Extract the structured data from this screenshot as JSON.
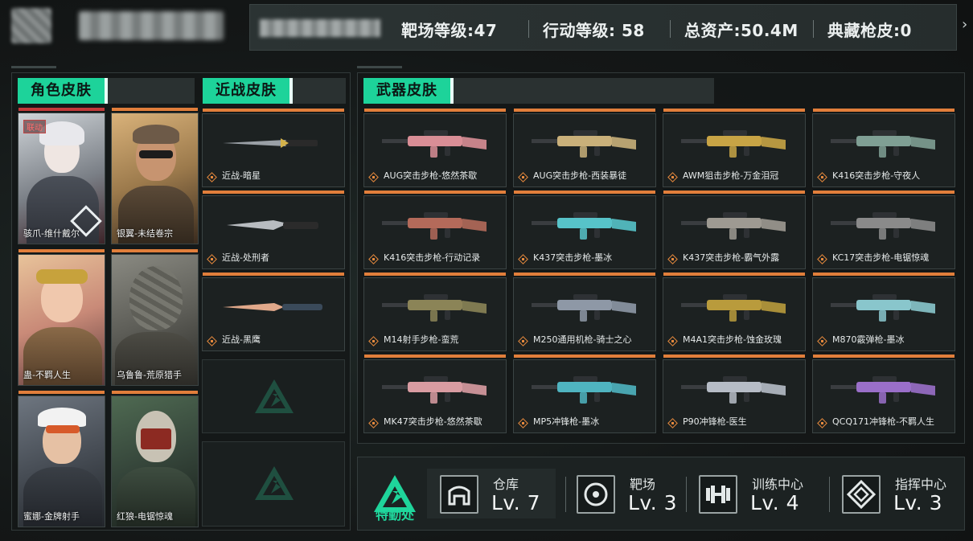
{
  "header": {
    "stats": [
      {
        "label": "靶场等级:47"
      },
      {
        "label": "行动等级: 58"
      },
      {
        "label": "总资产:50.4M"
      },
      {
        "label": "典藏枪皮:0"
      }
    ],
    "next_icon": "chevron-right-icon"
  },
  "character_skins": {
    "title": "角色皮肤",
    "items": [
      {
        "name": "骇爪-维什戴尔",
        "badge": "联动"
      },
      {
        "name": "银翼-未结卷宗"
      },
      {
        "name": "蛊-不羁人生"
      },
      {
        "name": "乌鲁鲁-荒原猎手"
      },
      {
        "name": "蜜娜-金牌射手"
      },
      {
        "name": "红狼-电锯惊魂"
      }
    ]
  },
  "melee_skins": {
    "title": "近战皮肤",
    "items": [
      {
        "name": "近战-暗星"
      },
      {
        "name": "近战-处刑者"
      },
      {
        "name": "近战-黑鹰"
      }
    ]
  },
  "weapon_skins": {
    "title": "武器皮肤",
    "items": [
      {
        "name": "AUG突击步枪-悠然茶歇",
        "color": "#d98e96"
      },
      {
        "name": "AUG突击步枪-西装暴徒",
        "color": "#c9b07a"
      },
      {
        "name": "AWM狙击步枪-万金泪冠",
        "color": "#c8a445"
      },
      {
        "name": "K416突击步枪-守夜人",
        "color": "#7f9f94"
      },
      {
        "name": "K416突击步枪-行动记录",
        "color": "#b46a5a"
      },
      {
        "name": "K437突击步枪-墨冰",
        "color": "#57c3c9"
      },
      {
        "name": "K437突击步枪-霸气外露",
        "color": "#9e9a92"
      },
      {
        "name": "KC17突击步枪-电锯惊魂",
        "color": "#8a8a8a"
      },
      {
        "name": "M14射手步枪-蛮荒",
        "color": "#8b8457"
      },
      {
        "name": "M250通用机枪-骑士之心",
        "color": "#8e98a6"
      },
      {
        "name": "M4A1突击步枪-蚀金玫瑰",
        "color": "#b99b3c"
      },
      {
        "name": "M870霰弹枪-墨冰",
        "color": "#89c6cc"
      },
      {
        "name": "MK47突击步枪-悠然茶歇",
        "color": "#d99ca2"
      },
      {
        "name": "MP5冲锋枪-墨冰",
        "color": "#4fb4c0"
      },
      {
        "name": "P90冲锋枪-医生",
        "color": "#b6bcc6"
      },
      {
        "name": "QCQ171冲锋枪-不羁人生",
        "color": "#9a6fc9"
      }
    ]
  },
  "facilities": {
    "logo_label": "特勤处",
    "items": [
      {
        "name": "仓库",
        "level": "Lv. 7",
        "icon": "warehouse-icon"
      },
      {
        "name": "靶场",
        "level": "Lv. 3",
        "icon": "target-icon"
      },
      {
        "name": "训练中心",
        "level": "Lv. 4",
        "icon": "dumbbell-icon"
      },
      {
        "name": "指挥中心",
        "level": "Lv. 3",
        "icon": "command-icon"
      }
    ]
  },
  "colors": {
    "accent": "#1dd39a",
    "card_stripe": "#e17e3b"
  }
}
